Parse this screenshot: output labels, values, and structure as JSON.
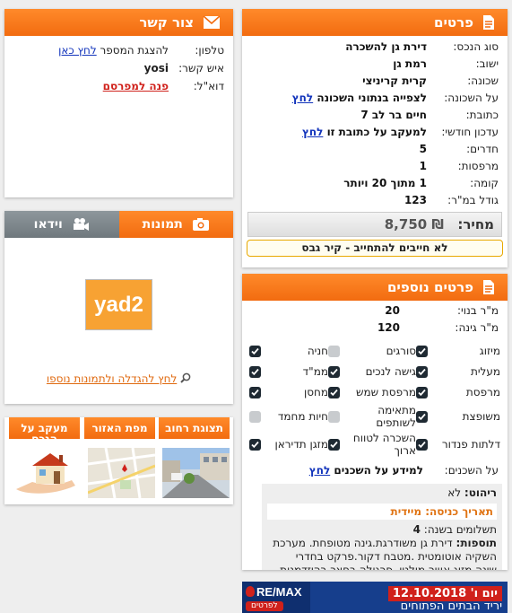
{
  "details": {
    "title": "פרטים",
    "rows": [
      {
        "label": "סוג הנכס:",
        "value": "דירת גן להשכרה"
      },
      {
        "label": "ישוב:",
        "value": "רמת גן"
      },
      {
        "label": "שכונה:",
        "value": "קרית קריניצי"
      },
      {
        "label": "על השכונה:",
        "value": "לצפייה בנתוני השכונה",
        "link": "לחץ"
      },
      {
        "label": "כתובת:",
        "value": "חיים בר לב 7"
      },
      {
        "label": "עדכון חודשי:",
        "value": "למעקב על כתובת זו",
        "link": "לחץ"
      },
      {
        "label": "חדרים:",
        "value": "5"
      },
      {
        "label": "מרפסות:",
        "value": "1"
      },
      {
        "label": "קומה:",
        "value": "1 מתוך 20 ויותר"
      },
      {
        "label": "גודל במ\"ר:",
        "value": "123"
      }
    ],
    "price_label": "מחיר:",
    "price_value": "₪ 8,750",
    "note": "לא חייבים להתחייב - קיר גבס"
  },
  "contact": {
    "title": "צור קשר",
    "phone_label": "טלפון:",
    "phone_text": "להצגת המספר",
    "phone_link": "לחץ כאן",
    "person_label": "איש קשר:",
    "person_value": "yosi",
    "email_label": "דוא\"ל:",
    "email_link": "פנה למפרסם"
  },
  "media": {
    "tab_photos": "תמונות",
    "tab_video": "וידאו",
    "logo_text": "yad2",
    "enlarge_link": "לחץ להגדלה ולתמונות נוספו"
  },
  "thumbs": [
    {
      "label": "תצוגת רחוב"
    },
    {
      "label": "מפת האזור"
    },
    {
      "label": "מעקב על הנכס"
    }
  ],
  "more": {
    "title": "פרטים נוספים",
    "built_label": "מ\"ר בנוי:",
    "built_value": "20",
    "garden_label": "מ\"ר גינה:",
    "garden_value": "120",
    "features": [
      {
        "label": "מיזוג",
        "checked": true
      },
      {
        "label": "סורגים",
        "checked": false
      },
      {
        "label": "חניה",
        "checked": true
      },
      {
        "label": "מעלית",
        "checked": true
      },
      {
        "label": "גישה לנכים",
        "checked": true
      },
      {
        "label": "ממ\"ד",
        "checked": true
      },
      {
        "label": "מרפסת",
        "checked": true
      },
      {
        "label": "מרפסת שמש",
        "checked": true
      },
      {
        "label": "מחסן",
        "checked": true
      },
      {
        "label": "משופצת",
        "checked": true
      },
      {
        "label": "מתאימה לשותפים",
        "checked": false
      },
      {
        "label": "חיות מחמד",
        "checked": false
      },
      {
        "label": "דלתות פנדור",
        "checked": true
      },
      {
        "label": "השכרה לטווח ארוך",
        "checked": true
      },
      {
        "label": "מזגן תדיראן",
        "checked": true
      }
    ],
    "neighbors_label": "על השכנים:",
    "neighbors_text": "למידע על השכנים",
    "neighbors_link": "לחץ",
    "furniture_label": "ריהוט:",
    "furniture_value": "לא",
    "entry_date": "תאריך כניסה: מיידית",
    "payments_label": "תשלומים בשנה:",
    "payments_value": "4",
    "extras_label": "תוספות:",
    "extras_text": "דירת גן משודרגת.גינה מטופחת. מערכת השקיה אוטומטית .מטבח דקור.פרקט בחדרי שינה.מזוג אוויר מולטי .פרגולה בחצר בהיזדמנות"
  },
  "banner": {
    "logo": "RE/MAX",
    "more": "לפרטים",
    "date": "יום ו' 12.10.2018",
    "title": "יריד הבתים הפתוחים"
  },
  "colors": {
    "accent": "#f26c10",
    "link": "#1133bb",
    "danger": "#d0211b"
  }
}
